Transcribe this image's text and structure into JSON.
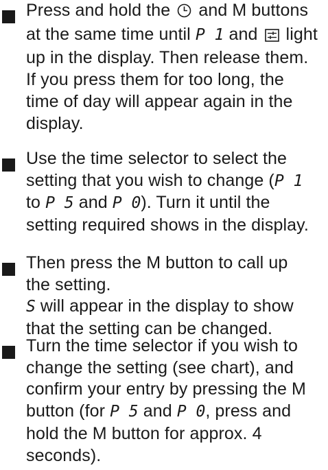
{
  "colors": {
    "text": "#1a1a1a",
    "background": "#ffffff"
  },
  "icons": {
    "timer_button": "clock-icon",
    "display_segment": "program-icon"
  },
  "steps": [
    {
      "lines": [
        [
          "Press and hold the ",
          "{clock}",
          " and M buttons"
        ],
        [
          "at the same time until ",
          "P 1",
          " and ",
          "{program}",
          " light"
        ],
        [
          "up in the display. Then release them."
        ],
        [
          "If you press them for too long, the"
        ],
        [
          "time of day will appear again in the"
        ],
        [
          "display."
        ]
      ]
    },
    {
      "lines": [
        [
          "Use the time selector to select the"
        ],
        [
          "setting that you wish to change (",
          "P 1"
        ],
        [
          "to ",
          "P 5",
          " and ",
          "P 0",
          "). Turn it until the"
        ],
        [
          "setting required shows in the display."
        ]
      ]
    },
    {
      "lines": [
        [
          "Then press the M button to call up"
        ],
        [
          "the setting."
        ],
        [
          "S",
          " will appear in the display to show"
        ],
        [
          "that the setting can be changed."
        ]
      ]
    },
    {
      "lines": [
        [
          "Turn the time selector if you wish to"
        ],
        [
          "change the setting (see chart), and"
        ],
        [
          "confirm your entry by pressing the M"
        ],
        [
          "button (for ",
          "P 5",
          " and ",
          "P 0",
          ", press and"
        ],
        [
          "hold the M button for approx. 4"
        ],
        [
          "seconds)."
        ]
      ]
    }
  ]
}
